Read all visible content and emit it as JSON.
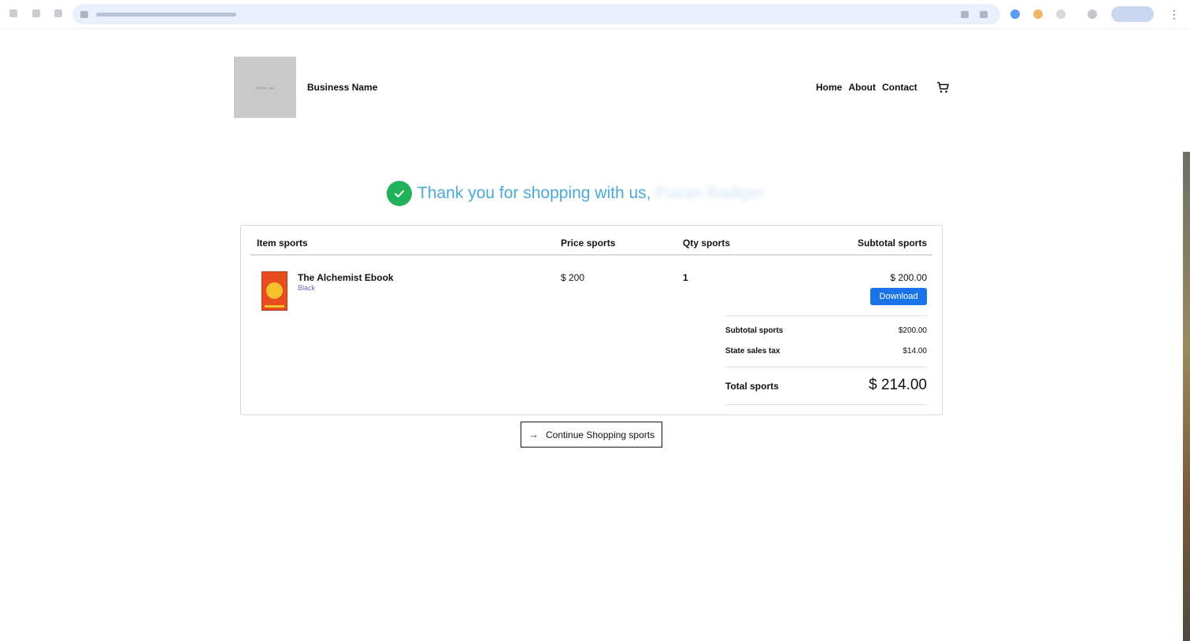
{
  "site": {
    "logo_text": "Put your logo",
    "business_name": "Business Name",
    "nav": [
      "Home",
      "About",
      "Contact"
    ]
  },
  "confirmation": {
    "message": "Thank you for shopping with us,",
    "customer_name": "Pavan Badiger"
  },
  "order": {
    "headers": {
      "item": "Item sports",
      "price": "Price sports",
      "qty": "Qty sports",
      "subtotal": "Subtotal sports"
    },
    "items": [
      {
        "name": "The Alchemist Ebook",
        "variant": "Black",
        "price": "$ 200",
        "qty": "1",
        "subtotal": "$ 200.00",
        "action": "Download"
      }
    ],
    "summary": {
      "subtotal_label": "Subtotal sports",
      "subtotal_value": "$200.00",
      "tax_label": "State sales tax",
      "tax_value": "$14.00",
      "total_label": "Total sports",
      "total_value": "$ 214.00"
    }
  },
  "continue_label": "Continue Shopping sports",
  "colors": {
    "accent": "#1a73e8",
    "success": "#20b15a",
    "heading": "#4aa9d8"
  }
}
